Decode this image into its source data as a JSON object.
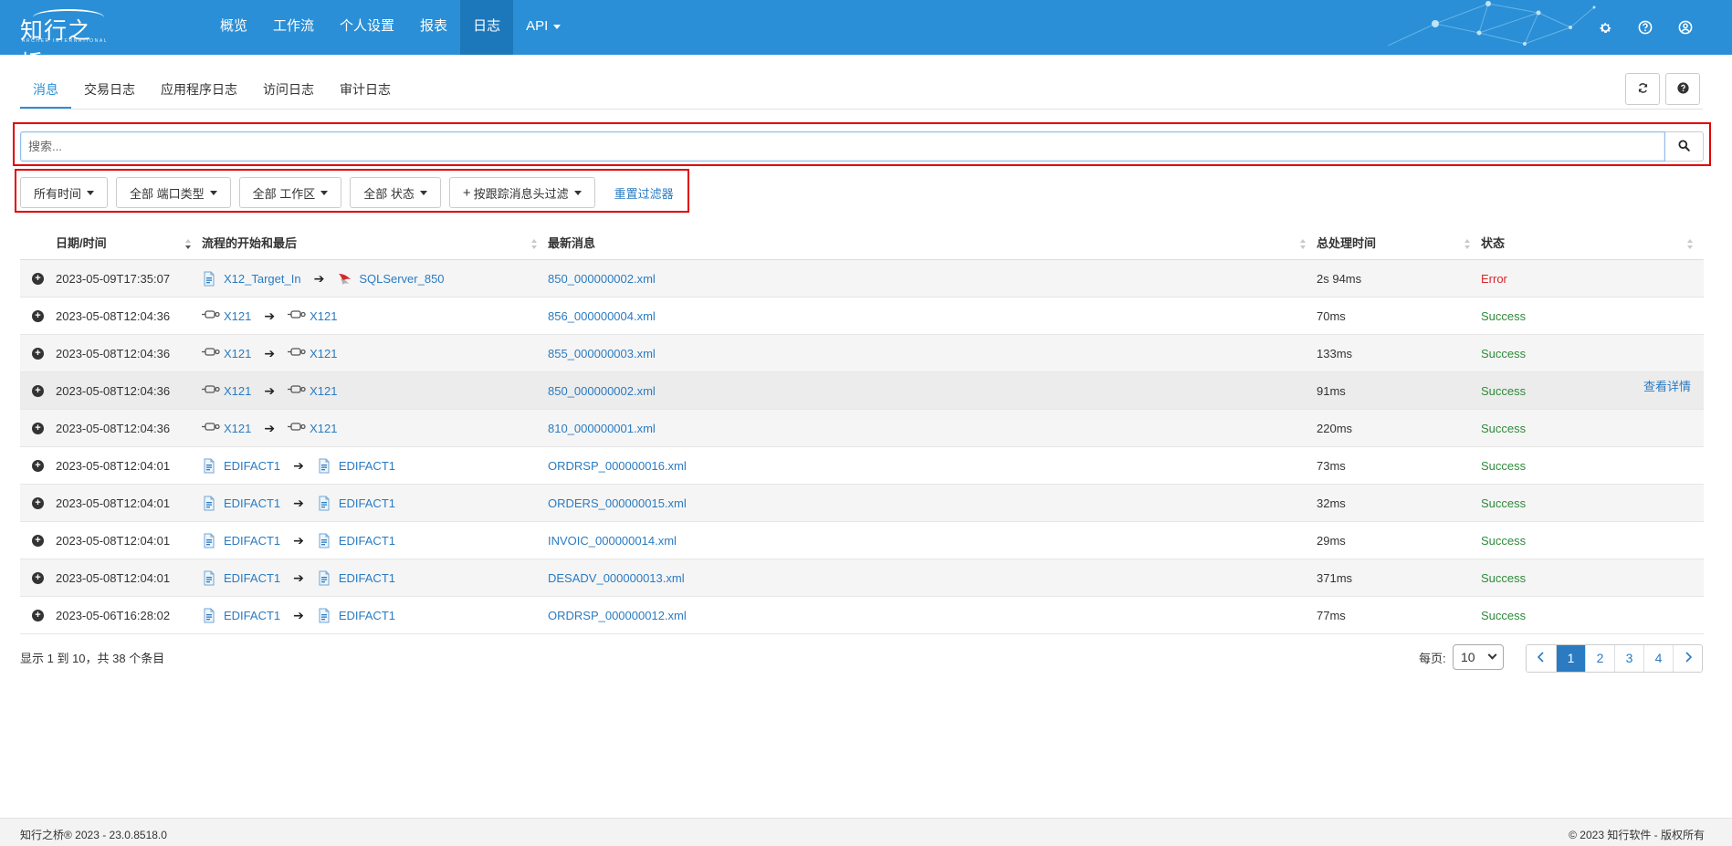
{
  "brand": {
    "logo_text": "知行之桥",
    "logo_sub": "ARCHER INTERNATIONAL"
  },
  "nav": {
    "items": [
      {
        "label": "概览"
      },
      {
        "label": "工作流"
      },
      {
        "label": "个人设置"
      },
      {
        "label": "报表"
      },
      {
        "label": "日志",
        "active": true
      },
      {
        "label": "API",
        "dropdown": true
      }
    ],
    "icons": [
      "gear-icon",
      "help-circle-icon",
      "user-circle-icon"
    ]
  },
  "tabs": [
    {
      "label": "消息",
      "active": true
    },
    {
      "label": "交易日志"
    },
    {
      "label": "应用程序日志"
    },
    {
      "label": "访问日志"
    },
    {
      "label": "审计日志"
    }
  ],
  "search": {
    "placeholder": "搜索...",
    "value": ""
  },
  "filters": {
    "time": "所有时间",
    "port_type": "全部 端口类型",
    "workspace": "全部 工作区",
    "status": "全部 状态",
    "header_filter": "按跟踪消息头过滤",
    "reset": "重置过滤器"
  },
  "table": {
    "headers": {
      "datetime": "日期/时间",
      "flow": "流程的开始和最后",
      "latest": "最新消息",
      "duration": "总处理时间",
      "status": "状态"
    },
    "details_label": "查看详情",
    "rows": [
      {
        "datetime": "2023-05-09T17:35:07",
        "from": "X12_Target_In",
        "from_icon": "document-icon",
        "to": "SQLServer_850",
        "to_icon": "sqlserver-icon",
        "latest": "850_000000002.xml",
        "duration": "2s 94ms",
        "status": "Error",
        "status_color": "#d9262a"
      },
      {
        "datetime": "2023-05-08T12:04:36",
        "from": "X121",
        "from_icon": "connector-icon",
        "to": "X121",
        "to_icon": "connector-icon",
        "latest": "856_000000004.xml",
        "duration": "70ms",
        "status": "Success",
        "status_color": "#2e8b3a"
      },
      {
        "datetime": "2023-05-08T12:04:36",
        "from": "X121",
        "from_icon": "connector-icon",
        "to": "X121",
        "to_icon": "connector-icon",
        "latest": "855_000000003.xml",
        "duration": "133ms",
        "status": "Success",
        "status_color": "#2e8b3a"
      },
      {
        "datetime": "2023-05-08T12:04:36",
        "from": "X121",
        "from_icon": "connector-icon",
        "to": "X121",
        "to_icon": "connector-icon",
        "latest": "850_000000002.xml",
        "duration": "91ms",
        "status": "Success",
        "status_color": "#2e8b3a",
        "show_details": true
      },
      {
        "datetime": "2023-05-08T12:04:36",
        "from": "X121",
        "from_icon": "connector-icon",
        "to": "X121",
        "to_icon": "connector-icon",
        "latest": "810_000000001.xml",
        "duration": "220ms",
        "status": "Success",
        "status_color": "#2e8b3a"
      },
      {
        "datetime": "2023-05-08T12:04:01",
        "from": "EDIFACT1",
        "from_icon": "document-icon",
        "to": "EDIFACT1",
        "to_icon": "document-icon",
        "latest": "ORDRSP_000000016.xml",
        "duration": "73ms",
        "status": "Success",
        "status_color": "#2e8b3a"
      },
      {
        "datetime": "2023-05-08T12:04:01",
        "from": "EDIFACT1",
        "from_icon": "document-icon",
        "to": "EDIFACT1",
        "to_icon": "document-icon",
        "latest": "ORDERS_000000015.xml",
        "duration": "32ms",
        "status": "Success",
        "status_color": "#2e8b3a"
      },
      {
        "datetime": "2023-05-08T12:04:01",
        "from": "EDIFACT1",
        "from_icon": "document-icon",
        "to": "EDIFACT1",
        "to_icon": "document-icon",
        "latest": "INVOIC_000000014.xml",
        "duration": "29ms",
        "status": "Success",
        "status_color": "#2e8b3a"
      },
      {
        "datetime": "2023-05-08T12:04:01",
        "from": "EDIFACT1",
        "from_icon": "document-icon",
        "to": "EDIFACT1",
        "to_icon": "document-icon",
        "latest": "DESADV_000000013.xml",
        "duration": "371ms",
        "status": "Success",
        "status_color": "#2e8b3a"
      },
      {
        "datetime": "2023-05-06T16:28:02",
        "from": "EDIFACT1",
        "from_icon": "document-icon",
        "to": "EDIFACT1",
        "to_icon": "document-icon",
        "latest": "ORDRSP_000000012.xml",
        "duration": "77ms",
        "status": "Success",
        "status_color": "#2e8b3a"
      }
    ]
  },
  "pagination": {
    "summary": "显示 1 到 10，共 38 个条目",
    "per_page_label": "每页:",
    "per_page_value": "10",
    "pages": [
      "1",
      "2",
      "3",
      "4"
    ],
    "current_page": "1"
  },
  "footer": {
    "left": "知行之桥® 2023 - 23.0.8518.0",
    "right": "© 2023 知行软件 - 版权所有"
  }
}
